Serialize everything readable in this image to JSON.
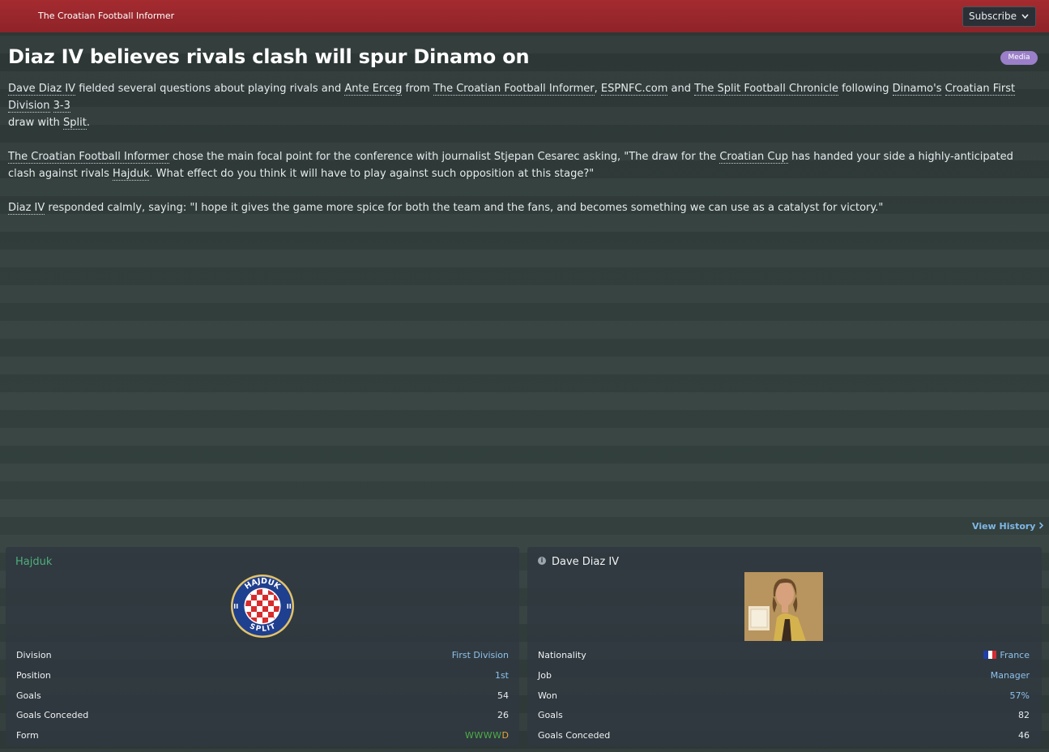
{
  "header": {
    "publication": "The Croatian Football Informer",
    "subscribe_label": "Subscribe",
    "colors": {
      "bar": "#9b2a2e"
    }
  },
  "article": {
    "headline": "Diaz IV believes rivals clash will spur Dinamo on",
    "category_badge": "Media",
    "badge_color": "#9b7fc9",
    "p1": {
      "t1": "Dave Diaz IV",
      "t2": " fielded several questions about playing rivals and ",
      "t3": "Ante Erceg",
      "t4": " from ",
      "t5": "The Croatian Football Informer",
      "t6": ", ",
      "t7": "ESPNFC.com",
      "t8": " and ",
      "t9": "The Split Football Chronicle",
      "t10": " following ",
      "t11": "Dinamo's",
      "t12": " ",
      "t13": "Croatian First Division",
      "t14": " ",
      "t15": "3-3",
      "t16": " draw with ",
      "t17": "Split",
      "t18": "."
    },
    "p2": {
      "t1": "The Croatian Football Informer",
      "t2": " chose the main focal point for the conference with journalist Stjepan Cesarec asking, \"The draw for the ",
      "t3": "Croatian Cup",
      "t4": " has handed your side a highly-anticipated clash against rivals ",
      "t5": "Hajduk",
      "t6": ". What effect do you think it will have to play against such opposition at this stage?\""
    },
    "p3": {
      "t1": "Diaz IV",
      "t2": " responded calmly, saying: \"I hope it gives the game more spice for both the team and the fans, and becomes something we can use as a catalyst for victory.\""
    },
    "view_history": "View History"
  },
  "club_panel": {
    "name": "Hajduk",
    "crest_text_top": "HAJDUK",
    "crest_text_bottom": "SPLIT",
    "rows": {
      "division": {
        "label": "Division",
        "value": "First Division"
      },
      "position": {
        "label": "Position",
        "value": "1st"
      },
      "goals": {
        "label": "Goals",
        "value": "54"
      },
      "conceded": {
        "label": "Goals Conceded",
        "value": "26"
      },
      "form": {
        "label": "Form",
        "wins": "WWWW",
        "draw": "D"
      }
    }
  },
  "manager_panel": {
    "name": "Dave Diaz IV",
    "info_icon": "info-icon",
    "rows": {
      "nationality": {
        "label": "Nationality",
        "value": "France",
        "flag": "france-flag-icon"
      },
      "job": {
        "label": "Job",
        "value": "Manager"
      },
      "won": {
        "label": "Won",
        "value": "57%"
      },
      "goals": {
        "label": "Goals",
        "value": "82"
      },
      "conceded": {
        "label": "Goals Conceded",
        "value": "46"
      }
    }
  }
}
